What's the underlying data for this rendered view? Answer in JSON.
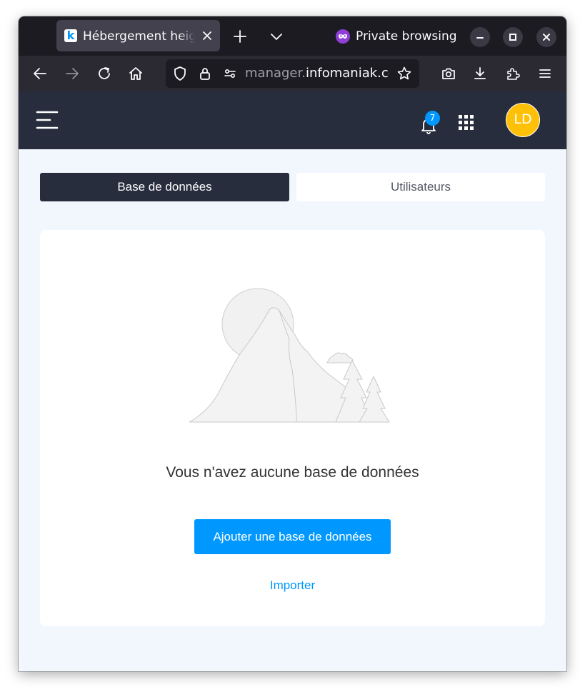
{
  "browser": {
    "tab": {
      "favicon_letter": "k",
      "title": "Hébergement heig-vd"
    },
    "private_label": "Private browsing",
    "url": {
      "prefix": "manager.",
      "host": "infomaniak.com"
    }
  },
  "app": {
    "notifications_count": "7",
    "avatar_initials": "LD",
    "accent_color": "#0098ff",
    "header_color": "#282d3e",
    "avatar_color": "#ffc107"
  },
  "tabs": {
    "active": "Base de données",
    "inactive": "Utilisateurs"
  },
  "empty_state": {
    "title": "Vous n'avez aucune base de données",
    "primary_action": "Ajouter une base de données",
    "secondary_action": "Importer"
  }
}
